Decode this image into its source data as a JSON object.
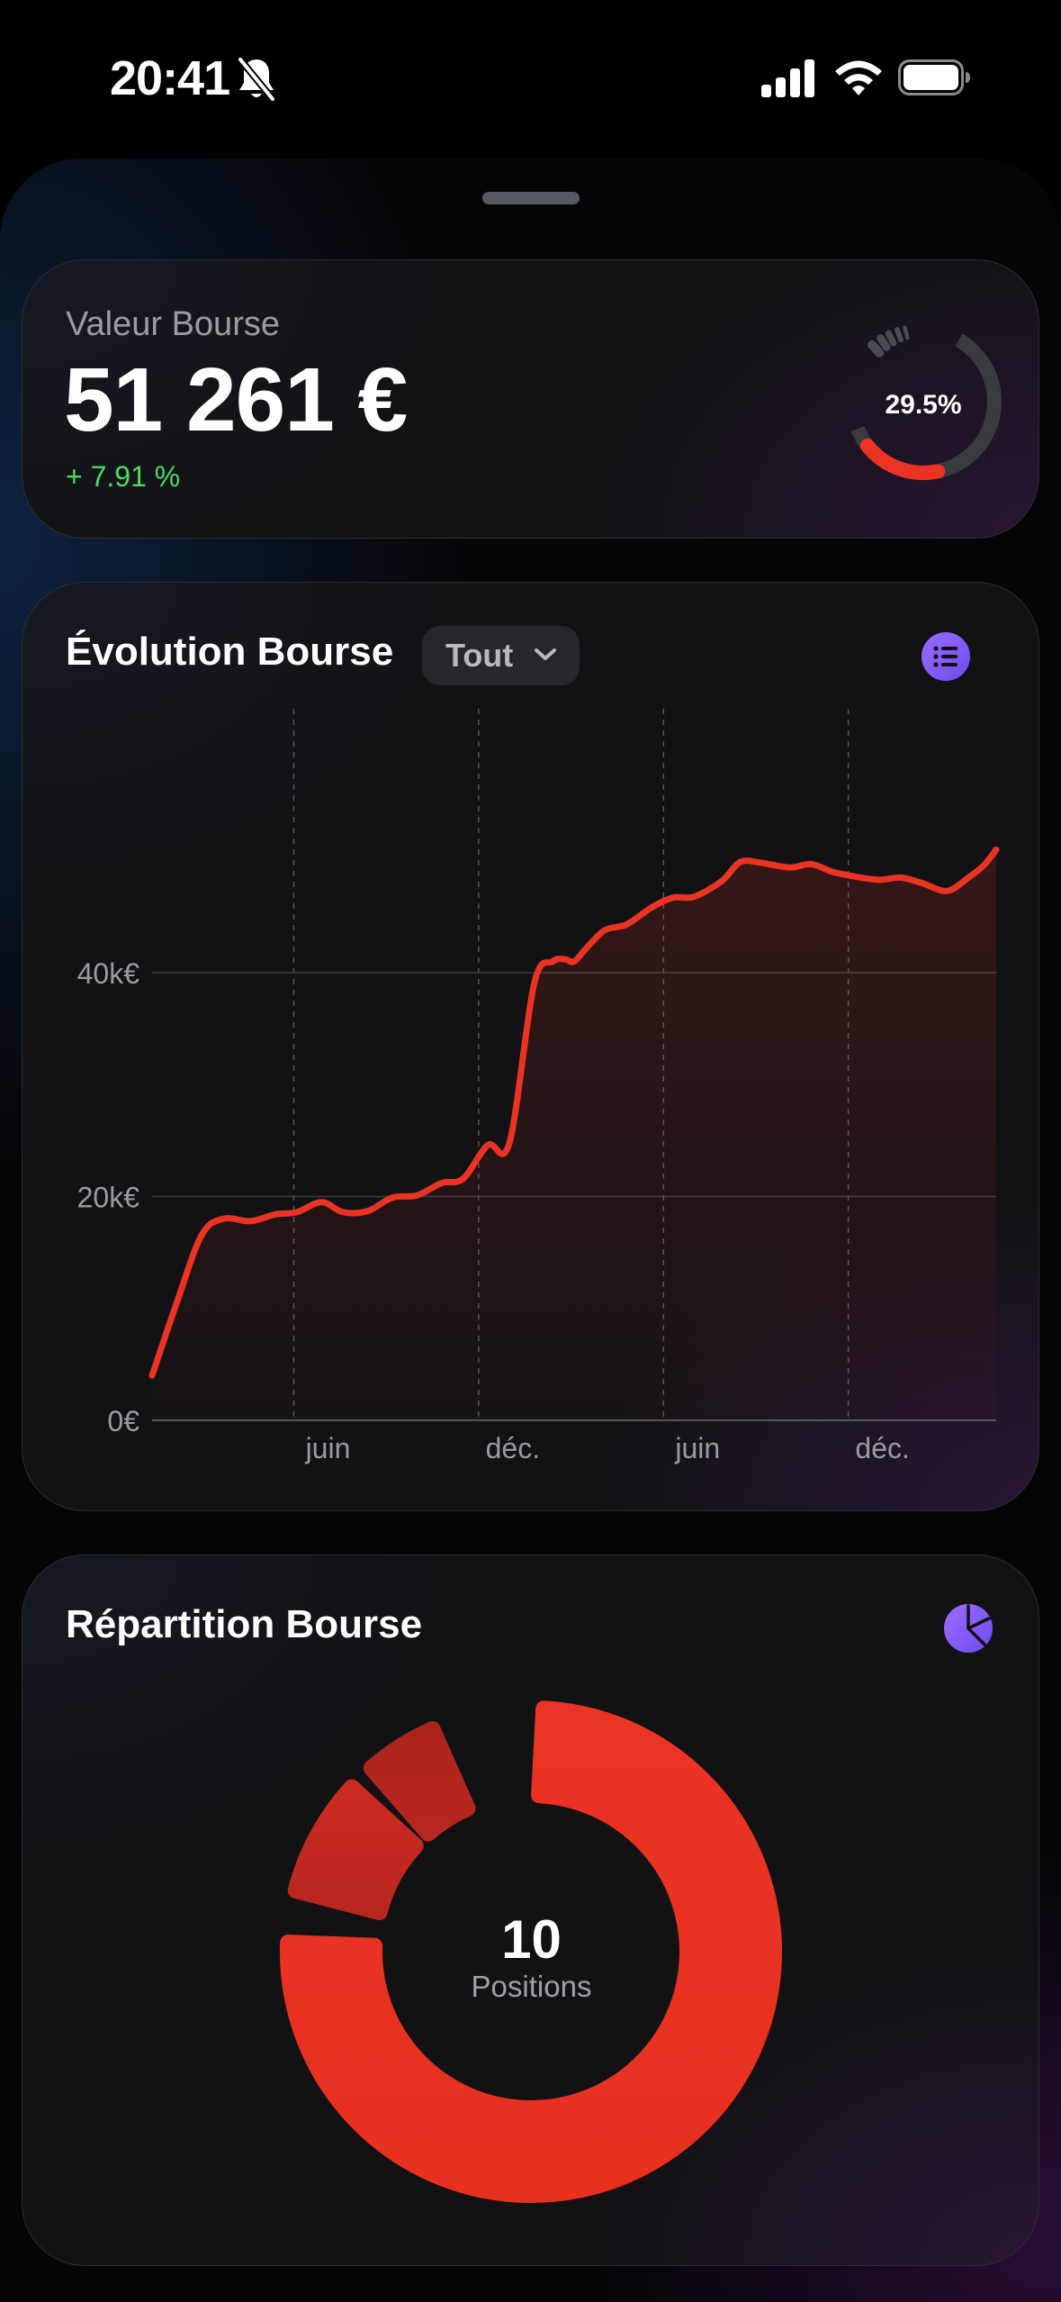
{
  "status_bar": {
    "time": "20:41",
    "icons": [
      "bell-slash-icon",
      "cellular-signal-icon",
      "wifi-icon",
      "battery-icon"
    ]
  },
  "valeur_card": {
    "label": "Valeur Bourse",
    "value": "51 261 €",
    "change": "+ 7.91 %",
    "gauge_text": "29.5%",
    "gauge_fraction": 0.295,
    "colors": {
      "accent": "#ea3323",
      "positive": "#4cd964"
    }
  },
  "evolution_card": {
    "title": "Évolution Bourse",
    "period_button": "Tout",
    "list_icon": "list-icon"
  },
  "chart_data": {
    "type": "area",
    "title": "Évolution Bourse",
    "xlabel": "",
    "ylabel": "",
    "y_ticks": [
      "0€",
      "20k€",
      "40k€"
    ],
    "y_tick_values": [
      0,
      20000,
      40000
    ],
    "x_tick_labels": [
      "juin",
      "déc.",
      "juin",
      "déc."
    ],
    "x_tick_months": [
      6,
      12,
      18,
      24
    ],
    "ylim": [
      0,
      60000
    ],
    "xlim": [
      1.4,
      28.8
    ],
    "grid": true,
    "series": [
      {
        "color": "#ea3323",
        "x": [
          1.4,
          2.2,
          3.0,
          3.7,
          4.6,
          5.4,
          6.1,
          6.9,
          7.6,
          8.4,
          9.2,
          10.0,
          10.8,
          11.5,
          12.3,
          13.0,
          13.8,
          14.4,
          14.8,
          15.1,
          15.5,
          16.1,
          16.8,
          17.6,
          18.3,
          19.0,
          19.9,
          20.5,
          21.2,
          22.1,
          22.8,
          23.5,
          24.2,
          25.0,
          25.7,
          26.4,
          27.2,
          27.9,
          28.4,
          28.8
        ],
        "y": [
          4000,
          10500,
          16500,
          18000,
          17800,
          18400,
          18600,
          19500,
          18600,
          18700,
          19900,
          20100,
          21200,
          21600,
          24600,
          24800,
          39000,
          41000,
          41200,
          41000,
          42200,
          43800,
          44300,
          45800,
          46700,
          46800,
          48200,
          49900,
          49800,
          49400,
          49700,
          49000,
          48600,
          48300,
          48500,
          48000,
          47300,
          48500,
          49600,
          51000
        ]
      }
    ]
  },
  "repartition_card": {
    "title": "Répartition Bourse",
    "pie_icon": "pie-chart-icon",
    "count": "10",
    "count_label": "Positions",
    "segments": [
      {
        "fraction": 0.76,
        "color": "#ea3323"
      },
      {
        "fraction": 0.09,
        "color": "#cc2a20"
      },
      {
        "fraction": 0.06,
        "color": "#aa241c"
      }
    ]
  }
}
